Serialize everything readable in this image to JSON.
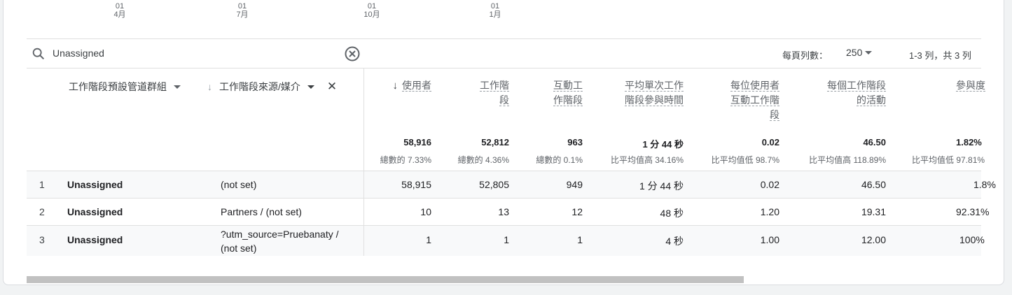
{
  "axis_ticks": [
    {
      "day": "01",
      "month": "4月"
    },
    {
      "day": "01",
      "month": "7月"
    },
    {
      "day": "01",
      "month": "10月"
    },
    {
      "day": "01",
      "month": "1月"
    }
  ],
  "search": {
    "value": "Unassigned"
  },
  "pagination": {
    "rows_label": "每頁列數：",
    "rows_value": "250",
    "range": "1-3 列，共 3 列"
  },
  "dimensions": [
    {
      "label": "工作階段預設管道群組"
    },
    {
      "label": "工作階段來源/媒介"
    }
  ],
  "metrics": [
    {
      "lines": [
        "使用者"
      ],
      "total": "58,916",
      "sub": "總數的 7.33%"
    },
    {
      "lines": [
        "工作階",
        "段"
      ],
      "total": "52,812",
      "sub": "總數的 4.36%"
    },
    {
      "lines": [
        "互動工",
        "作階段"
      ],
      "total": "963",
      "sub": "總數的 0.1%"
    },
    {
      "lines": [
        "平均單次工作",
        "階段參與時間"
      ],
      "total": "1 分 44 秒",
      "sub": "比平均值高 34.16%"
    },
    {
      "lines": [
        "每位使用者",
        "互動工作階",
        "段"
      ],
      "total": "0.02",
      "sub": "比平均值低 98.7%"
    },
    {
      "lines": [
        "每個工作階段",
        "的活動"
      ],
      "total": "46.50",
      "sub": "比平均值高 118.89%"
    },
    {
      "lines": [
        "參與度"
      ],
      "total": "1.82%",
      "sub": "比平均值低 97.81%"
    }
  ],
  "rows": [
    {
      "idx": "1",
      "group": "Unassigned",
      "source": [
        "(not set)"
      ],
      "values": [
        "58,915",
        "52,805",
        "949",
        "1 分 44 秒",
        "0.02",
        "46.50",
        "1.8%"
      ]
    },
    {
      "idx": "2",
      "group": "Unassigned",
      "source": [
        "Partners / (not set)"
      ],
      "values": [
        "10",
        "13",
        "12",
        "48 秒",
        "1.20",
        "19.31",
        "92.31%"
      ]
    },
    {
      "idx": "3",
      "group": "Unassigned",
      "source": [
        "?utm_source=Pruebanaty /",
        "(not set)"
      ],
      "values": [
        "1",
        "1",
        "1",
        "4 秒",
        "1.00",
        "12.00",
        "100%"
      ]
    }
  ]
}
